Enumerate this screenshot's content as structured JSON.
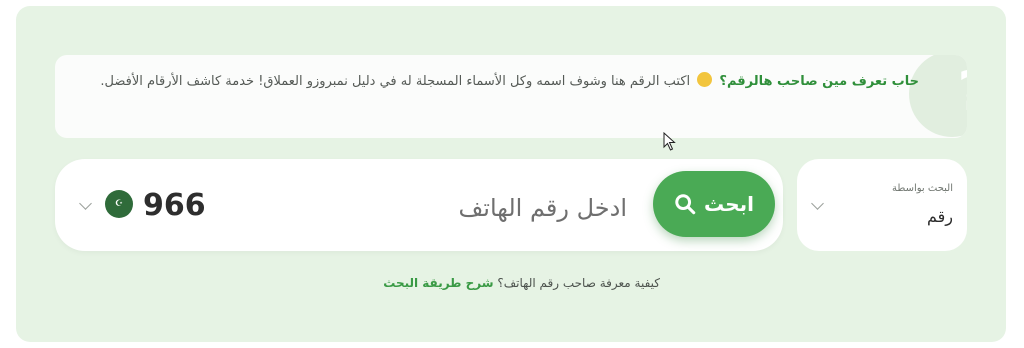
{
  "info": {
    "highlight": "حاب تعرف مين صاحب هالرقم؟",
    "body": "اكتب الرقم هنا وشوف اسمه وكل الأسماء المسجلة له في دليل نمبروزو العملاق! خدمة كاشف الأرقام الأفضل."
  },
  "search": {
    "button_label": "ابحث",
    "placeholder": "ادخل رقم الهاتف",
    "country_code": "966",
    "flag_icon": "saudi-flag-icon"
  },
  "search_by": {
    "label": "البحث بواسطة",
    "value": "رقم"
  },
  "help": {
    "question": "كيفية معرفة صاحب رقم الهاتف؟",
    "link": "شرح طريقة البحث"
  },
  "colors": {
    "accent": "#4aaa55",
    "panel_bg": "#e6f3e4",
    "link": "#3a9a45"
  }
}
